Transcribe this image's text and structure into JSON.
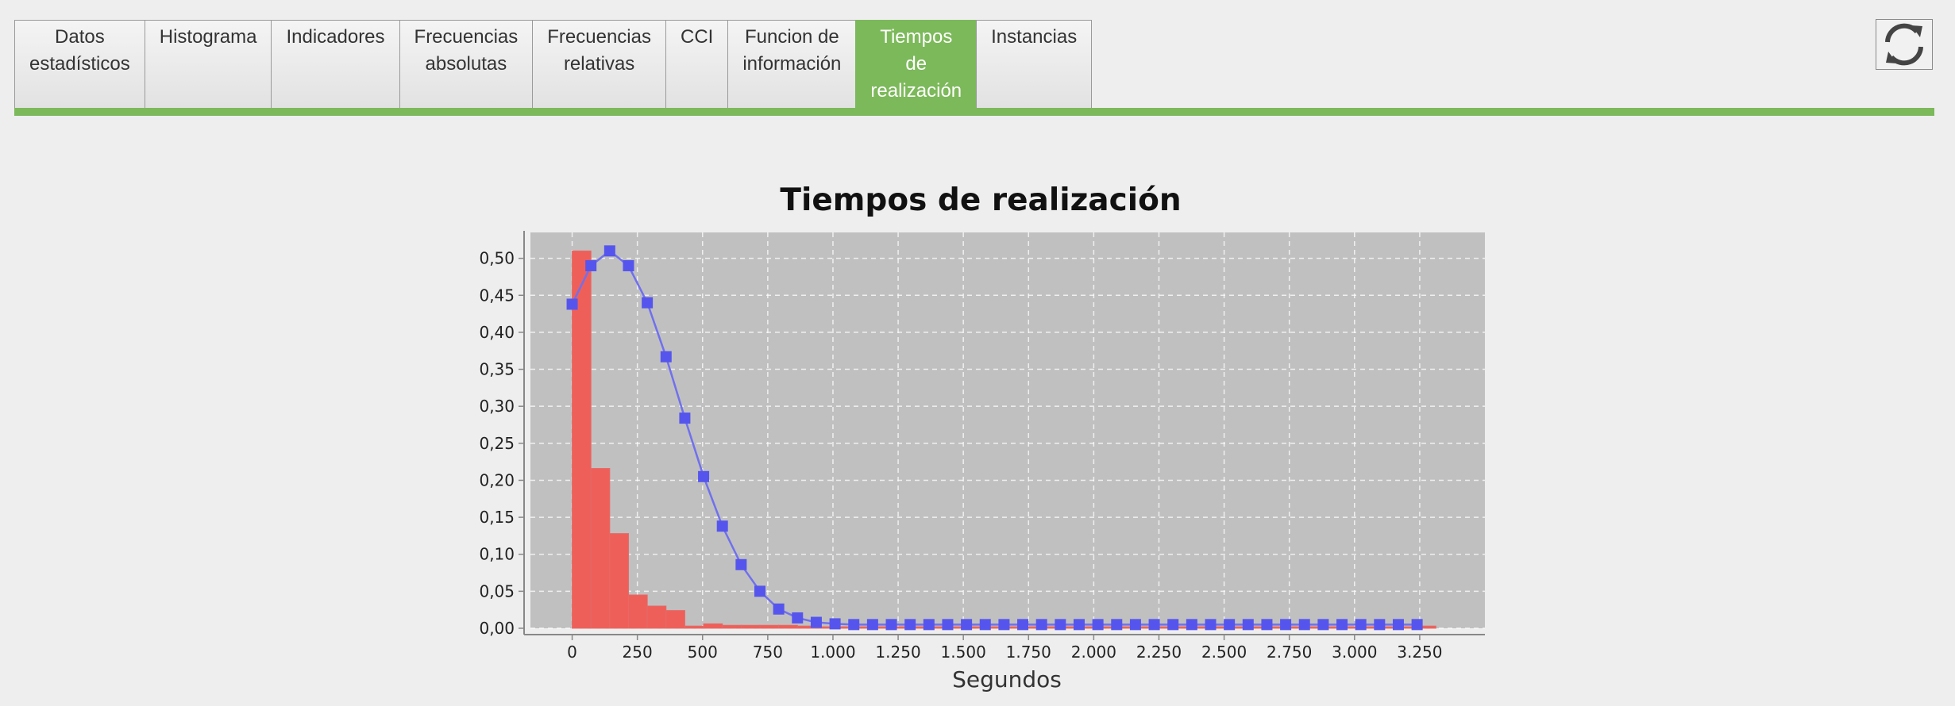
{
  "tabs": [
    {
      "label": "Datos\nestadísticos",
      "active": false
    },
    {
      "label": "Histograma",
      "active": false
    },
    {
      "label": "Indicadores",
      "active": false
    },
    {
      "label": "Frecuencias\nabsolutas",
      "active": false
    },
    {
      "label": "Frecuencias\nrelativas",
      "active": false
    },
    {
      "label": "CCI",
      "active": false
    },
    {
      "label": "Funcion de\ninformación",
      "active": false
    },
    {
      "label": "Tiempos\nde\nrealización",
      "active": true
    },
    {
      "label": "Instancias",
      "active": false
    }
  ],
  "colors": {
    "accent": "#7cb95a",
    "plot_background": "#c0c0c0",
    "bars": "#ef5f59",
    "line": "#5555ee"
  },
  "refresh_icon": "refresh-icon",
  "chart_data": {
    "type": "bar",
    "title": "Tiempos de realización",
    "xlabel": "Segundos",
    "ylabel": "",
    "xlim": [
      -160,
      3500
    ],
    "ylim": [
      0,
      0.535
    ],
    "grid": true,
    "x_ticks": [
      0,
      250,
      500,
      750,
      1000,
      1250,
      1500,
      1750,
      2000,
      2250,
      2500,
      2750,
      3000,
      3250
    ],
    "x_tick_labels": [
      "0",
      "250",
      "500",
      "750",
      "1.000",
      "1.250",
      "1.500",
      "1.750",
      "2.000",
      "2.250",
      "2.500",
      "2.750",
      "3.000",
      "3.250"
    ],
    "y_ticks": [
      0,
      0.05,
      0.1,
      0.15,
      0.2,
      0.25,
      0.3,
      0.35,
      0.4,
      0.45,
      0.5
    ],
    "y_tick_labels": [
      "0,00",
      "0,05",
      "0,10",
      "0,15",
      "0,20",
      "0,25",
      "0,30",
      "0,35",
      "0,40",
      "0,45",
      "0,50"
    ],
    "bars": {
      "bin_width": 72,
      "bin_starts": [
        0,
        72,
        144,
        216,
        288,
        360,
        432,
        504,
        576,
        648,
        720,
        792,
        864,
        936,
        1008,
        1080,
        1152,
        1224,
        1296,
        1368,
        1440,
        1512,
        1584,
        1656,
        1728,
        1800,
        1872,
        1944,
        2016,
        2088,
        2160,
        2232,
        2304,
        2376,
        2448,
        2520,
        2592,
        2664,
        2736,
        2808,
        2880,
        2952,
        3024,
        3096,
        3168,
        3240
      ],
      "values": [
        0.51,
        0.216,
        0.128,
        0.045,
        0.03,
        0.024,
        0.003,
        0.006,
        0.004,
        0.004,
        0.004,
        0.004,
        0.003,
        0.002,
        0.002,
        0.002,
        0.002,
        0.002,
        0.002,
        0.002,
        0.002,
        0.002,
        0.002,
        0.002,
        0.002,
        0.002,
        0.002,
        0.002,
        0.002,
        0.002,
        0.002,
        0.002,
        0.002,
        0.002,
        0.002,
        0.002,
        0.002,
        0.002,
        0.002,
        0.002,
        0.002,
        0.002,
        0.002,
        0.002,
        0.002,
        0.003
      ]
    },
    "series": [
      {
        "type": "line",
        "x": [
          0,
          72,
          144,
          216,
          288,
          360,
          432,
          504,
          576,
          648,
          720,
          792,
          864,
          936,
          1008,
          1080,
          1152,
          1224,
          1296,
          1368,
          1440,
          1512,
          1584,
          1656,
          1728,
          1800,
          1872,
          1944,
          2016,
          2088,
          2160,
          2232,
          2304,
          2376,
          2448,
          2520,
          2592,
          2664,
          2736,
          2808,
          2880,
          2952,
          3024,
          3096,
          3168,
          3240
        ],
        "y": [
          0.438,
          0.49,
          0.51,
          0.49,
          0.44,
          0.367,
          0.284,
          0.205,
          0.138,
          0.086,
          0.05,
          0.026,
          0.014,
          0.008,
          0.006,
          0.005,
          0.005,
          0.005,
          0.005,
          0.005,
          0.005,
          0.005,
          0.005,
          0.005,
          0.005,
          0.005,
          0.005,
          0.005,
          0.005,
          0.005,
          0.005,
          0.005,
          0.005,
          0.005,
          0.005,
          0.005,
          0.005,
          0.005,
          0.005,
          0.005,
          0.005,
          0.005,
          0.005,
          0.005,
          0.005,
          0.005
        ]
      }
    ]
  }
}
